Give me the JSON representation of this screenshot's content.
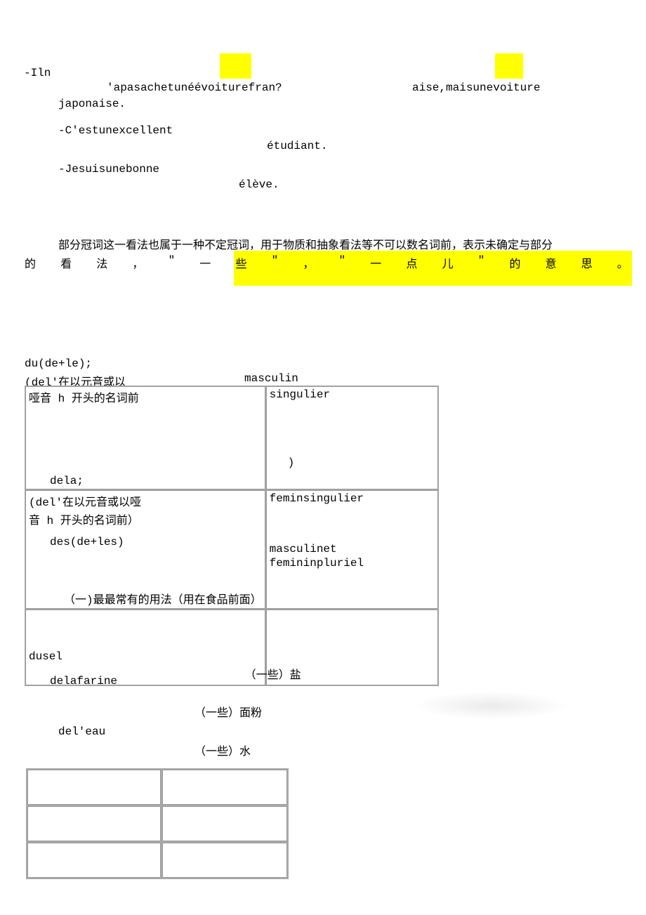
{
  "line1": {
    "dash_iln": "-Iln",
    "hl_space1": "    ",
    "hl_space2": "    "
  },
  "line2": {
    "apas": "'apasachetunéévoiturefran?",
    "aise": "aise,maisunevoiture"
  },
  "line3": {
    "japonaise": "japonaise."
  },
  "line4": {
    "cest": "-C'estunexcellent"
  },
  "line5": {
    "etudiant": "étudiant."
  },
  "line6": {
    "jesuis": "-Jesuisunebonne"
  },
  "line7": {
    "eleve": "élève."
  },
  "faint1": "",
  "paragraph1": "部分冠词这一看法也属于一种不定冠词，用于物质和抽象看法等不可以数名词前，表示未确定与部分",
  "justified": [
    "的",
    "看",
    "法",
    "，",
    "\"",
    "一",
    "些",
    "\"",
    "，",
    "\"",
    "一",
    "点",
    "儿",
    "\"",
    "的",
    "意",
    "思",
    "。"
  ],
  "du_line": "du(de+le);",
  "del_line1_a": "(del'在以元音或以",
  "del_line1_b": "masculin",
  "table1": {
    "r1c1_a": "哑音 h 开头的名词前",
    "r1c1_b": "dela;",
    "r1c2_a": "singulier",
    "r1c2_b": ")",
    "r2c1_a": "(del'在以元音或以哑",
    "r2c1_b": "音 h 开头的名词前）",
    "r2c1_c": "des(de+les)",
    "r2c1_d": "（一)最最常有的用法（用在食品前面）",
    "r2c2_a": "feminsingulier",
    "r2c2_b": "masculinet",
    "r2c2_c": "femininpluriel",
    "r3c1_a": "dusel",
    "r3c1_b": "delafarine",
    "r3c2_a": "（一些）盐"
  },
  "post_table": {
    "line1_a": "（一些）面粉",
    "line2_a": "del'eau",
    "line3_a": "（一些）水"
  }
}
